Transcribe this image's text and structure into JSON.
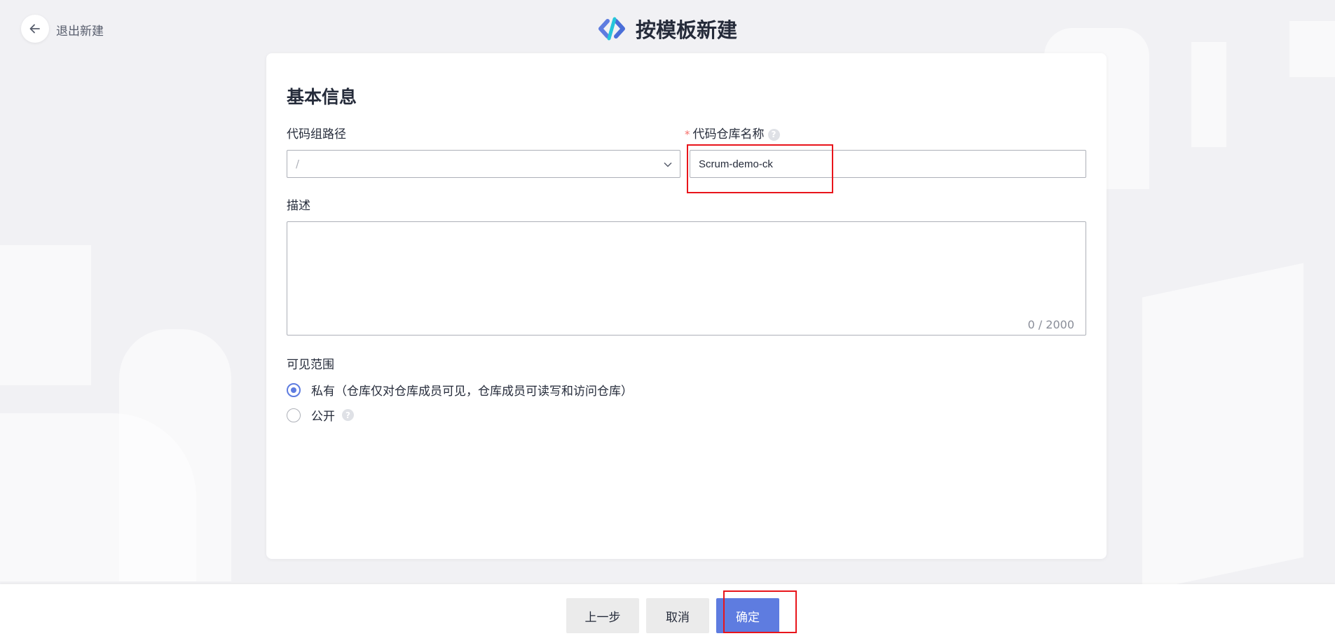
{
  "header": {
    "back_label": "退出新建",
    "title": "按模板新建"
  },
  "form": {
    "section_title": "基本信息",
    "group_path": {
      "label": "代码组路径",
      "value": "/"
    },
    "repo_name": {
      "label": "代码仓库名称",
      "required_mark": "*",
      "value": "Scrum-demo-ck"
    },
    "description": {
      "label": "描述",
      "value": "",
      "char_count": "0 / 2000"
    },
    "visibility": {
      "label": "可见范围",
      "options": [
        {
          "label": "私有（仓库仅对仓库成员可见，仓库成员可读写和访问仓库）",
          "checked": true
        },
        {
          "label": "公开",
          "checked": false
        }
      ]
    },
    "help_glyph": "?"
  },
  "footer": {
    "prev_label": "上一步",
    "cancel_label": "取消",
    "confirm_label": "确定"
  },
  "colors": {
    "primary": "#5e7ce0",
    "required": "#f66f6a",
    "highlight": "#e8151b",
    "background": "#f1f1f4"
  },
  "icons": {
    "back": "arrow-left-icon",
    "logo": "codehub-logo-icon",
    "dropdown": "chevron-down-icon",
    "help": "help-circle-icon"
  }
}
